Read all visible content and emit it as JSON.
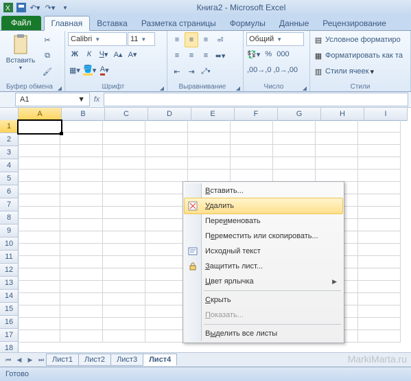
{
  "title": "Книга2  -  Microsoft Excel",
  "tabs": {
    "file": "Файл",
    "home": "Главная",
    "insert": "Вставка",
    "layout": "Разметка страницы",
    "formulas": "Формулы",
    "data": "Данные",
    "review": "Рецензирование"
  },
  "ribbon": {
    "clipboard": {
      "paste": "Вставить",
      "label": "Буфер обмена"
    },
    "font": {
      "name": "Calibri",
      "size": "11",
      "label": "Шрифт"
    },
    "align": {
      "label": "Выравнивание"
    },
    "number": {
      "format": "Общий",
      "label": "Число"
    },
    "styles": {
      "cond": "Условное форматиро",
      "fmt": "Форматировать как та",
      "cell": "Стили ячеек",
      "label": "Стили"
    }
  },
  "namebox": "A1",
  "columns": [
    "A",
    "B",
    "C",
    "D",
    "E",
    "F",
    "G",
    "H",
    "I"
  ],
  "rows": [
    "1",
    "2",
    "3",
    "4",
    "5",
    "6",
    "7",
    "8",
    "9",
    "10",
    "11",
    "12",
    "13",
    "14",
    "15",
    "16",
    "17",
    "18"
  ],
  "sheets": [
    "Лист1",
    "Лист2",
    "Лист3",
    "Лист4"
  ],
  "status": "Готово",
  "watermark": "MarkiMarta.ru",
  "context": {
    "insert": "Вставить...",
    "delete": "Удалить",
    "rename": "Переименовать",
    "move": "Переместить или скопировать...",
    "code": "Исходный текст",
    "protect": "Защитить лист...",
    "color": "Цвет ярлычка",
    "hide": "Скрыть",
    "show": "Показать...",
    "selectall": "Выделить все листы"
  }
}
